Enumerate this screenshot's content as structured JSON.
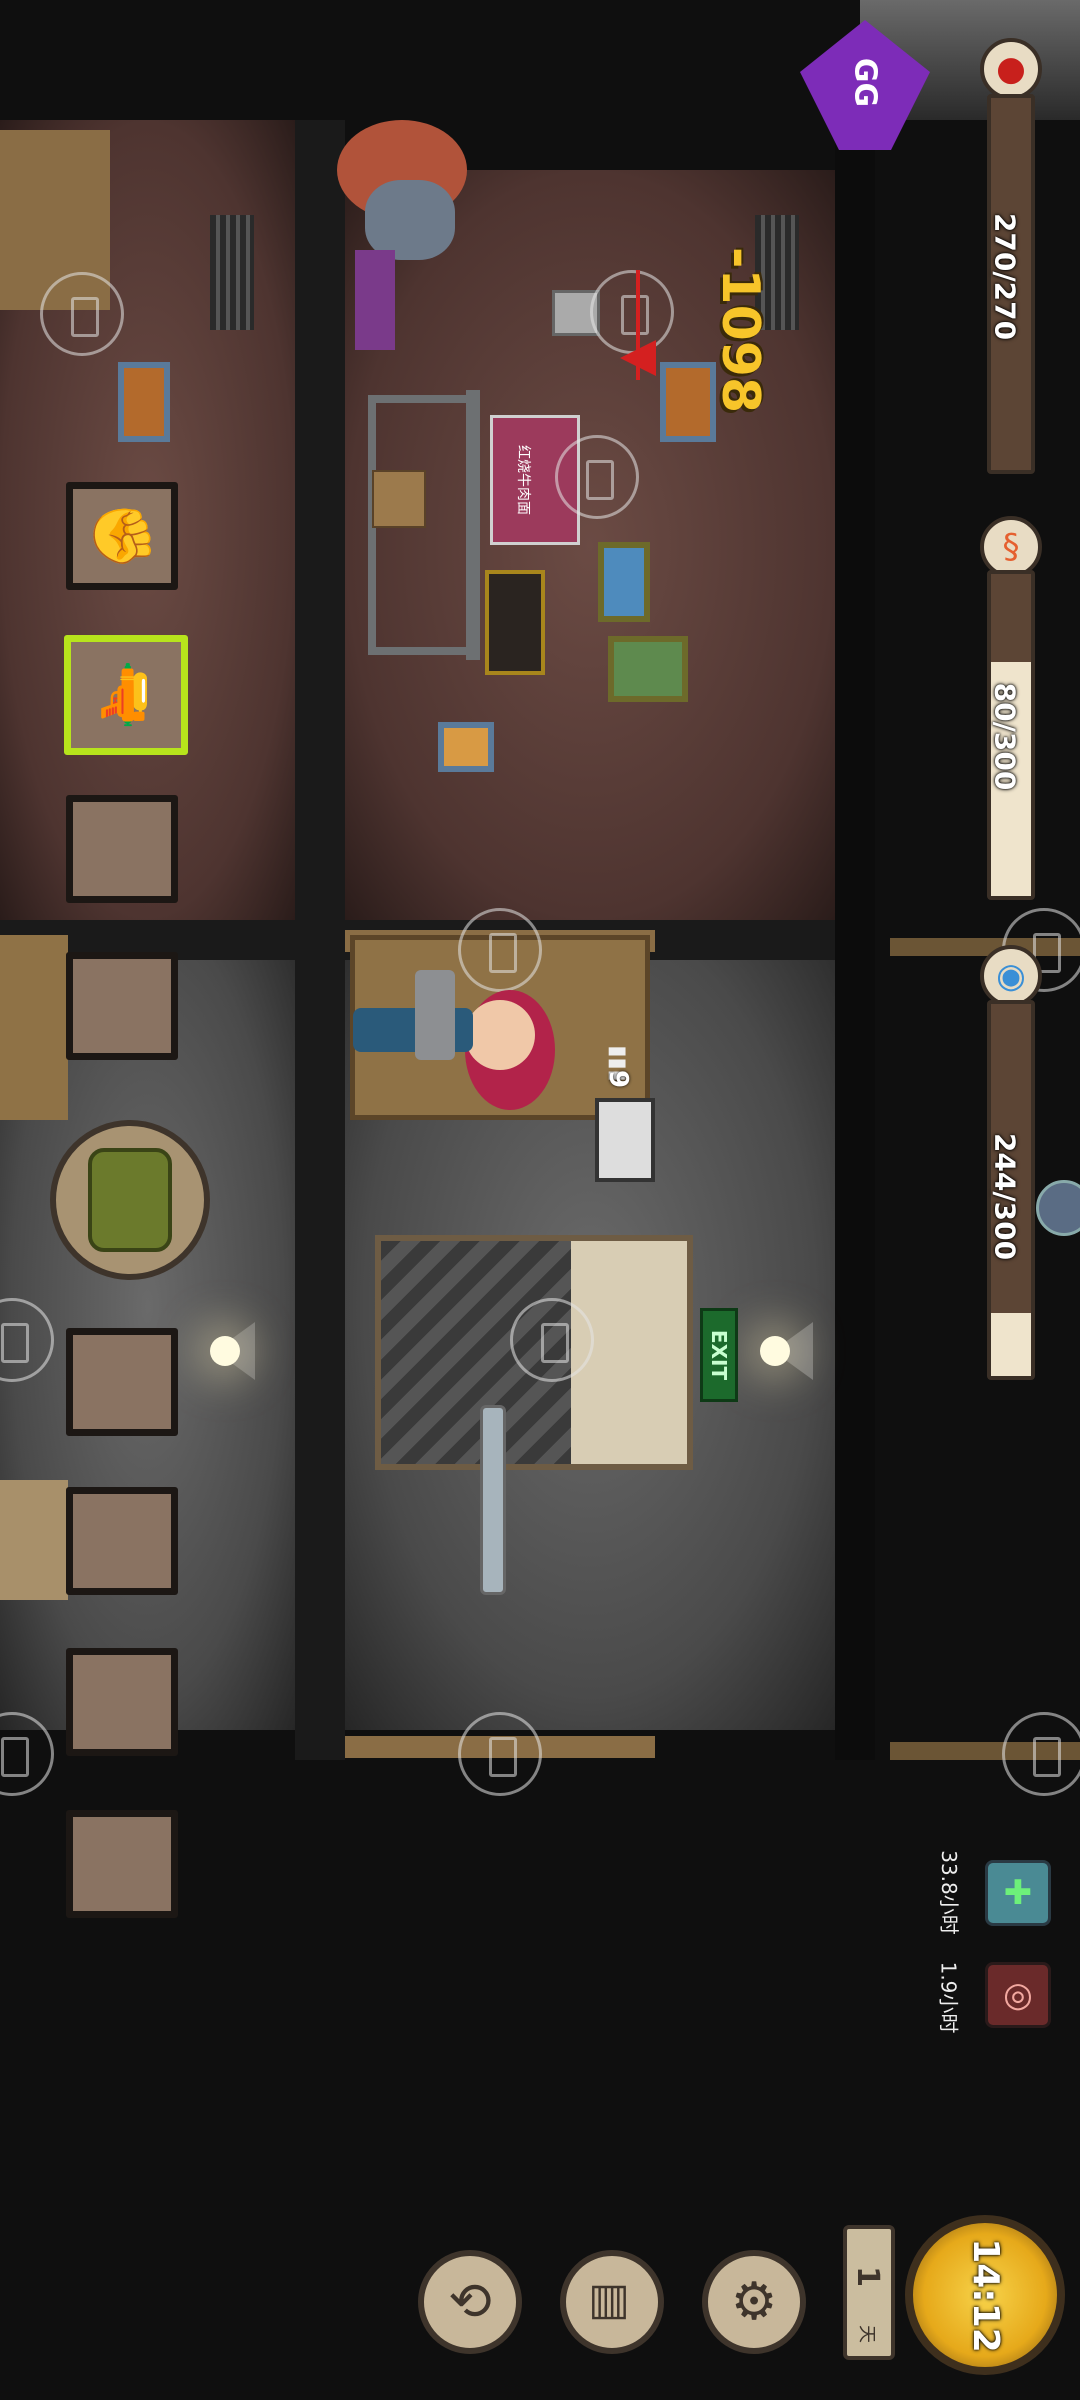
{
  "hud": {
    "health": {
      "label": "270/270",
      "value": 270,
      "max": 270,
      "icon": "blood-drop-icon",
      "color": "#c8201c"
    },
    "hunger": {
      "label": "80/300",
      "value": 80,
      "max": 300,
      "icon": "stomach-icon",
      "color": "#e56030"
    },
    "sanity": {
      "label": "244/300",
      "value": 244,
      "max": 300,
      "icon": "brain-icon",
      "color": "#3a8fd6"
    }
  },
  "gg_badge": {
    "text": "GG"
  },
  "damage_popup": {
    "text": "-1098"
  },
  "ammo": {
    "text": "9"
  },
  "exit_sign": {
    "text": "EXIT"
  },
  "sign_in_room": {
    "text": "红烧牛肉面"
  },
  "status_effects": [
    {
      "icon": "medkit-icon",
      "text": "33.8小时"
    },
    {
      "icon": "eye-icon",
      "text": "1.9小时"
    }
  ],
  "clock": {
    "time": "14:12",
    "day": "1",
    "day_suffix": "天"
  },
  "inventory": {
    "slots": [
      {
        "item": "fist-icon",
        "glyph": "✊",
        "selected": false
      },
      {
        "item": "revolver-icon",
        "glyph": "🔫",
        "selected": true
      },
      {
        "item": "empty",
        "glyph": "",
        "selected": false
      },
      {
        "item": "empty",
        "glyph": "",
        "selected": false
      },
      {
        "item": "empty",
        "glyph": "",
        "selected": false
      },
      {
        "item": "empty",
        "glyph": "",
        "selected": false
      },
      {
        "item": "empty",
        "glyph": "",
        "selected": false
      },
      {
        "item": "empty",
        "glyph": "",
        "selected": false
      }
    ],
    "backpack_icon": "backpack-icon"
  },
  "bottom_buttons": [
    {
      "name": "settings-button",
      "icon": "gear-icon",
      "glyph": "⚙"
    },
    {
      "name": "craft-button",
      "icon": "basket-icon",
      "glyph": "🧺"
    },
    {
      "name": "return-button",
      "icon": "return-icon",
      "glyph": "⟲"
    }
  ]
}
